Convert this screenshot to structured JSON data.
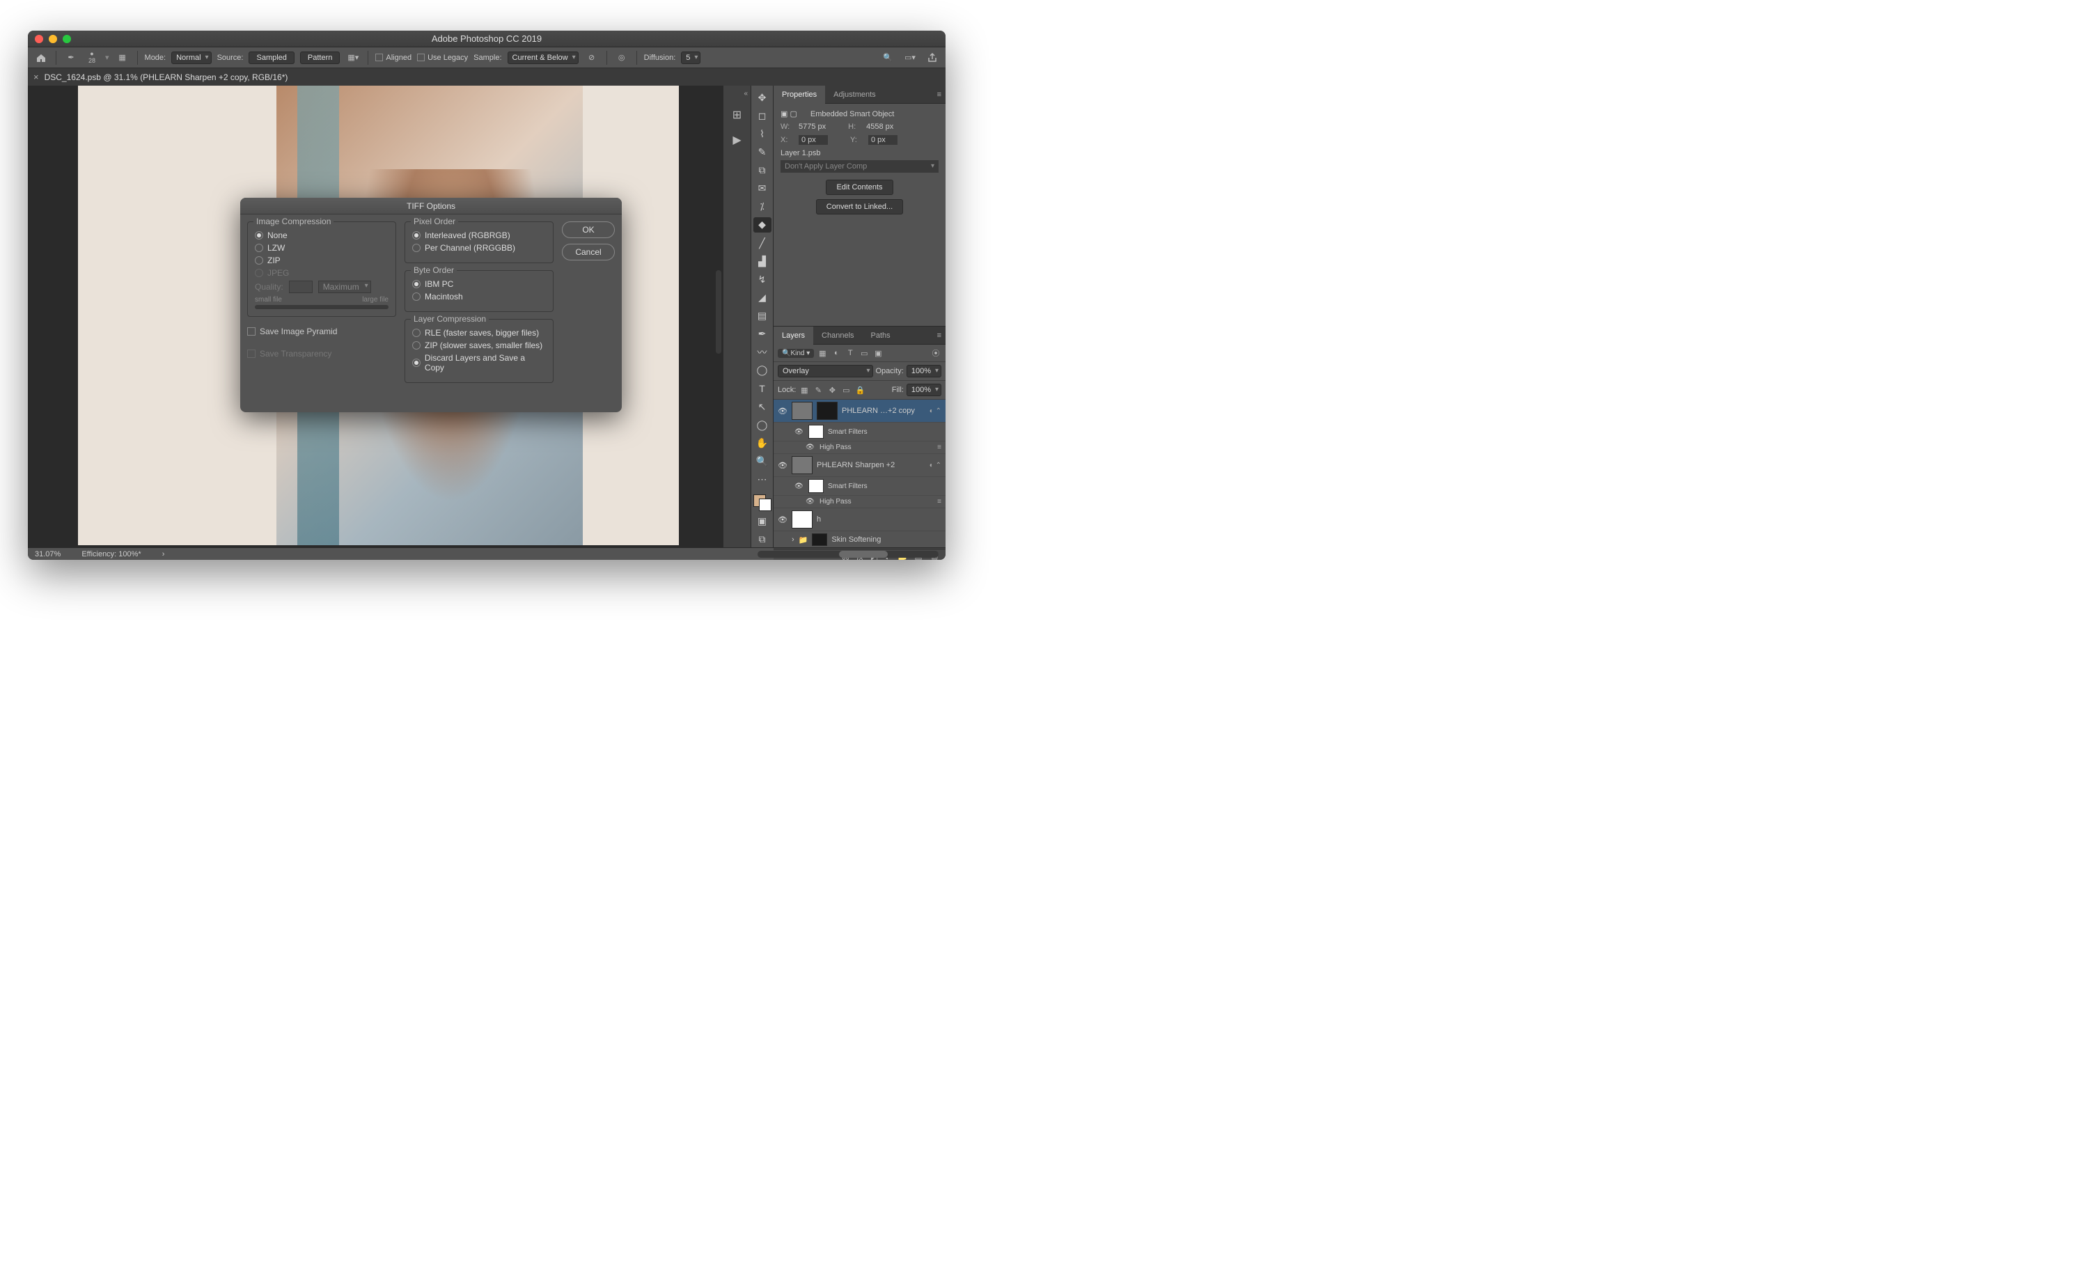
{
  "window": {
    "title": "Adobe Photoshop CC 2019"
  },
  "optbar": {
    "brush_label": "28",
    "mode_label": "Mode:",
    "mode_value": "Normal",
    "source_label": "Source:",
    "sampled": "Sampled",
    "pattern": "Pattern",
    "aligned": "Aligned",
    "legacy": "Use Legacy",
    "sample_label": "Sample:",
    "sample_value": "Current & Below",
    "diffusion_label": "Diffusion:",
    "diffusion_value": "5"
  },
  "tab": {
    "label": "DSC_1624.psb @ 31.1% (PHLEARN Sharpen +2 copy, RGB/16*)"
  },
  "status": {
    "zoom": "31.07%",
    "efficiency": "Efficiency: 100%*"
  },
  "properties": {
    "tabs": {
      "properties": "Properties",
      "adjustments": "Adjustments"
    },
    "type": "Embedded Smart Object",
    "w_label": "W:",
    "w": "5775 px",
    "h_label": "H:",
    "h": "4558 px",
    "x_label": "X:",
    "x": "0 px",
    "y_label": "Y:",
    "y": "0 px",
    "filename": "Layer 1.psb",
    "layercomp": "Don't Apply Layer Comp",
    "btn_edit": "Edit Contents",
    "btn_convert": "Convert to Linked..."
  },
  "layers": {
    "tabs": {
      "layers": "Layers",
      "channels": "Channels",
      "paths": "Paths"
    },
    "filter": "Kind",
    "blend": "Overlay",
    "opacity_label": "Opacity:",
    "opacity": "100%",
    "lock_label": "Lock:",
    "fill_label": "Fill:",
    "fill": "100%",
    "rows": [
      {
        "name": "PHLEARN …+2 copy",
        "selected": true
      },
      {
        "name": "Smart Filters",
        "sub": true
      },
      {
        "name": "High Pass",
        "sub2": true
      },
      {
        "name": "PHLEARN Sharpen +2"
      },
      {
        "name": "Smart Filters",
        "sub": true
      },
      {
        "name": "High Pass",
        "sub2": true
      },
      {
        "name": "h"
      },
      {
        "name": "Skin Softening",
        "group": true
      }
    ]
  },
  "dialog": {
    "title": "TIFF Options",
    "image_compression": {
      "label": "Image Compression",
      "none": "None",
      "lzw": "LZW",
      "zip": "ZIP",
      "jpeg": "JPEG",
      "quality": "Quality:",
      "max": "Maximum",
      "small": "small file",
      "large": "large file"
    },
    "save_pyramid": "Save Image Pyramid",
    "save_transparency": "Save Transparency",
    "pixel_order": {
      "label": "Pixel Order",
      "interleaved": "Interleaved (RGBRGB)",
      "per_channel": "Per Channel (RRGGBB)"
    },
    "byte_order": {
      "label": "Byte Order",
      "ibm": "IBM PC",
      "mac": "Macintosh"
    },
    "layer_compression": {
      "label": "Layer Compression",
      "rle": "RLE (faster saves, bigger files)",
      "zip": "ZIP (slower saves, smaller files)",
      "discard": "Discard Layers and Save a Copy"
    },
    "ok": "OK",
    "cancel": "Cancel"
  }
}
